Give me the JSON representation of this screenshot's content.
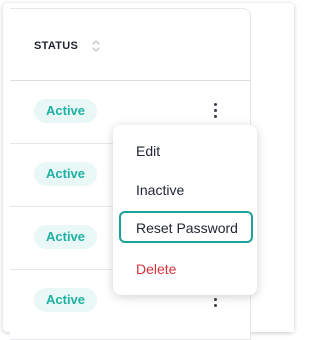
{
  "table": {
    "column_header": "STATUS",
    "rows": [
      {
        "status": "Active"
      },
      {
        "status": "Active"
      },
      {
        "status": "Active"
      },
      {
        "status": "Active"
      }
    ]
  },
  "row_menu": {
    "items": [
      {
        "label": "Edit"
      },
      {
        "label": "Inactive"
      },
      {
        "label": "Reset Password"
      },
      {
        "label": "Delete"
      }
    ]
  },
  "colors": {
    "badge_bg": "#e9f8f6",
    "badge_text": "#1fb2a3",
    "selected_outline": "#1aa39a",
    "delete_text": "#d6333b"
  },
  "icons": {
    "sort": "sort-icon",
    "row_actions": "more-vertical-icon"
  }
}
